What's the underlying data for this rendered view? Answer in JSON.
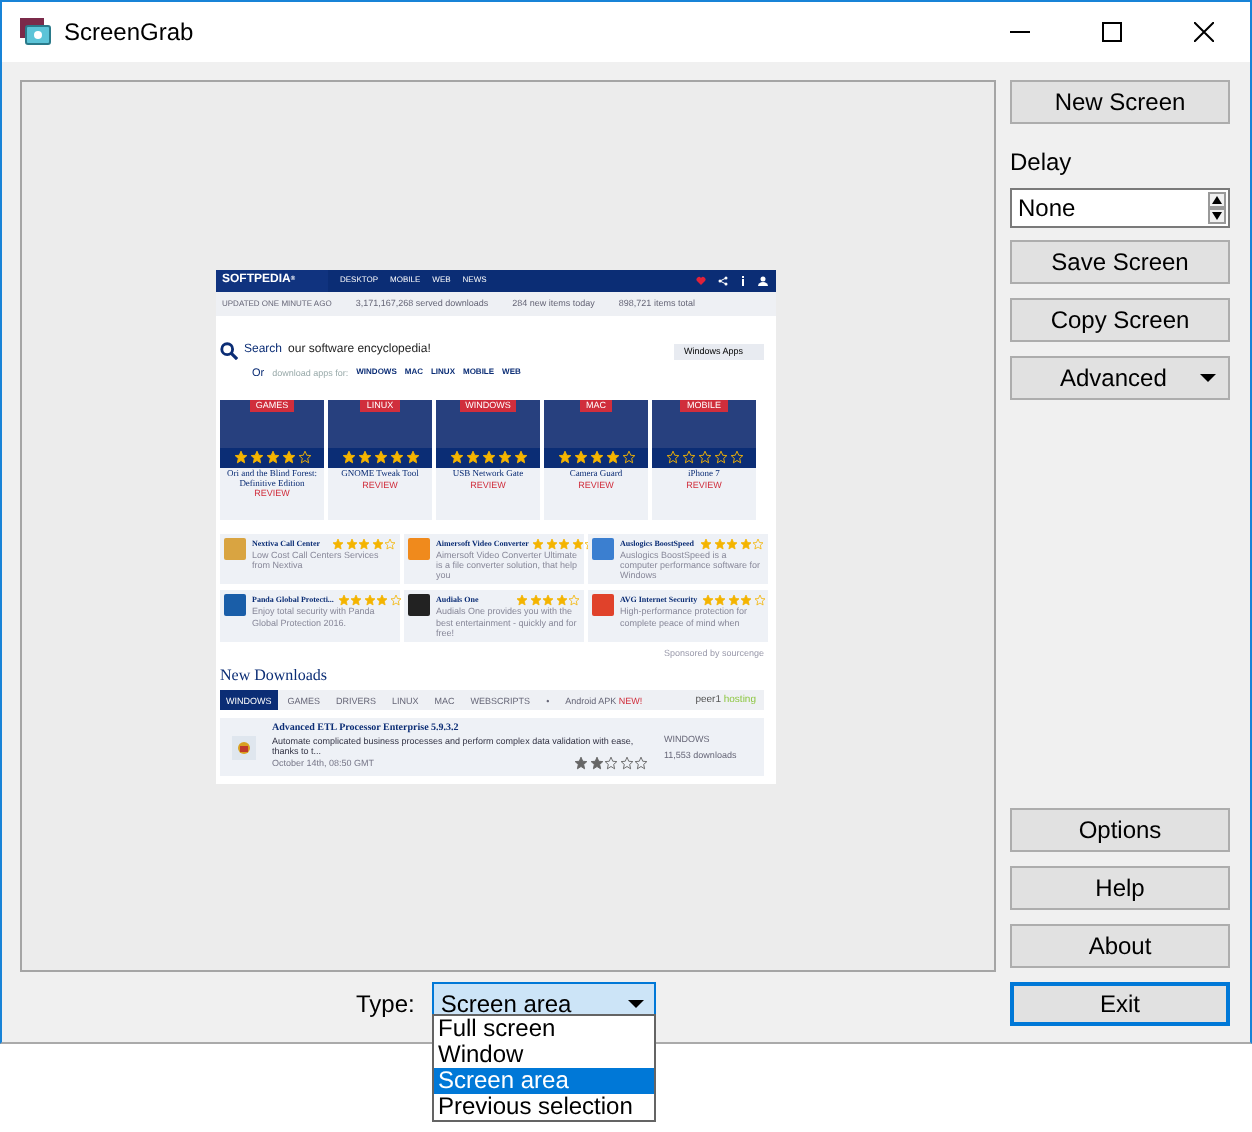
{
  "window": {
    "title": "ScreenGrab"
  },
  "preview": {
    "header": {
      "logo": "SOFTPEDIA",
      "logo_mark": "®",
      "tagline": "UPDATED ONE MINUTE AGO",
      "nav": [
        "DESKTOP",
        "MOBILE",
        "WEB",
        "NEWS"
      ],
      "stats": [
        "3,171,167,268  served downloads",
        "284 new items today",
        "898,721 items total"
      ]
    },
    "search": {
      "label": "Search",
      "placeholder": "our software encyclopedia!",
      "scope": "Windows Apps"
    },
    "platforms": {
      "prefix": "Or",
      "hint": "download apps for:",
      "items": [
        "WINDOWS",
        "MAC",
        "LINUX",
        "MOBILE",
        "WEB"
      ]
    },
    "featured": [
      {
        "category": "GAMES",
        "stars": 4,
        "title": "Ori and the Blind Forest: Definitive Edition",
        "review": "REVIEW"
      },
      {
        "category": "LINUX",
        "stars": 5,
        "title": "GNOME Tweak Tool",
        "review": "REVIEW"
      },
      {
        "category": "WINDOWS",
        "stars": 5,
        "title": "USB Network Gate",
        "review": "REVIEW"
      },
      {
        "category": "MAC",
        "stars": 4,
        "title": "Camera Guard",
        "review": "REVIEW"
      },
      {
        "category": "MOBILE",
        "stars": 0,
        "title": "iPhone 7",
        "review": "REVIEW"
      }
    ],
    "apps": [
      {
        "name": "Nextiva Call Center",
        "stars": 4,
        "desc": "Low Cost Call Centers Services from Nextiva",
        "color": "#d9a441"
      },
      {
        "name": "Aimersoft Video Converter",
        "stars": 4,
        "desc": "Aimersoft Video Converter Ultimate is a file converter solution, that help you",
        "color": "#f08a1c"
      },
      {
        "name": "Auslogics BoostSpeed",
        "stars": 4,
        "desc": "Auslogics BoostSpeed is a computer performance software for Windows",
        "color": "#3b7fd0"
      },
      {
        "name": "Panda Global Protecti...",
        "stars": 4,
        "desc": "Enjoy total security with Panda Global Protection 2016.",
        "color": "#1a5ea8"
      },
      {
        "name": "Audials One",
        "stars": 4,
        "desc": "Audials One provides you with the best entertainment - quickly and for free!",
        "color": "#222222"
      },
      {
        "name": "AVG Internet Security",
        "stars": 4,
        "desc": "High-performance protection for complete peace of mind when",
        "color": "#e0422b"
      }
    ],
    "sponsored": "Sponsored by sourcenge",
    "new_downloads": {
      "title": "New Downloads",
      "tabs": [
        {
          "label": "WINDOWS",
          "selected": true
        },
        {
          "label": "GAMES",
          "selected": false
        },
        {
          "label": "DRIVERS",
          "selected": false
        },
        {
          "label": "LINUX",
          "selected": false
        },
        {
          "label": "MAC",
          "selected": false
        },
        {
          "label": "WEBSCRIPTS",
          "selected": false
        },
        {
          "label": "•",
          "selected": false
        },
        {
          "label": "Android APK",
          "badge": "NEW!",
          "selected": false
        }
      ],
      "hosting": [
        "peer1",
        "hosting"
      ],
      "item": {
        "title": "Advanced ETL Processor Enterprise 5.9.3.2",
        "desc": "Automate complicated business processes and perform complex data validation with ease, thanks to t...",
        "date": "October 14th, 08:50 GMT",
        "stars": 2,
        "platform": "WINDOWS",
        "downloads": "11,553 downloads"
      }
    }
  },
  "buttons_top": [
    "New Screen"
  ],
  "delay": {
    "label": "Delay",
    "value": "None"
  },
  "buttons_mid": [
    {
      "label": "Save Screen"
    },
    {
      "label": "Copy Screen"
    },
    {
      "label": "Advanced",
      "kind": "menu"
    }
  ],
  "buttons_bottom": [
    {
      "label": "Options",
      "default": false
    },
    {
      "label": "Help",
      "default": false
    },
    {
      "label": "About",
      "default": false
    },
    {
      "label": "Exit",
      "default": true
    }
  ],
  "type": {
    "label": "Type:",
    "value": "Screen area",
    "expanded": true,
    "options": [
      {
        "label": "Full screen",
        "selected": false
      },
      {
        "label": "Window",
        "selected": false
      },
      {
        "label": "Screen area",
        "selected": true
      },
      {
        "label": "Previous selection",
        "selected": false
      }
    ]
  }
}
